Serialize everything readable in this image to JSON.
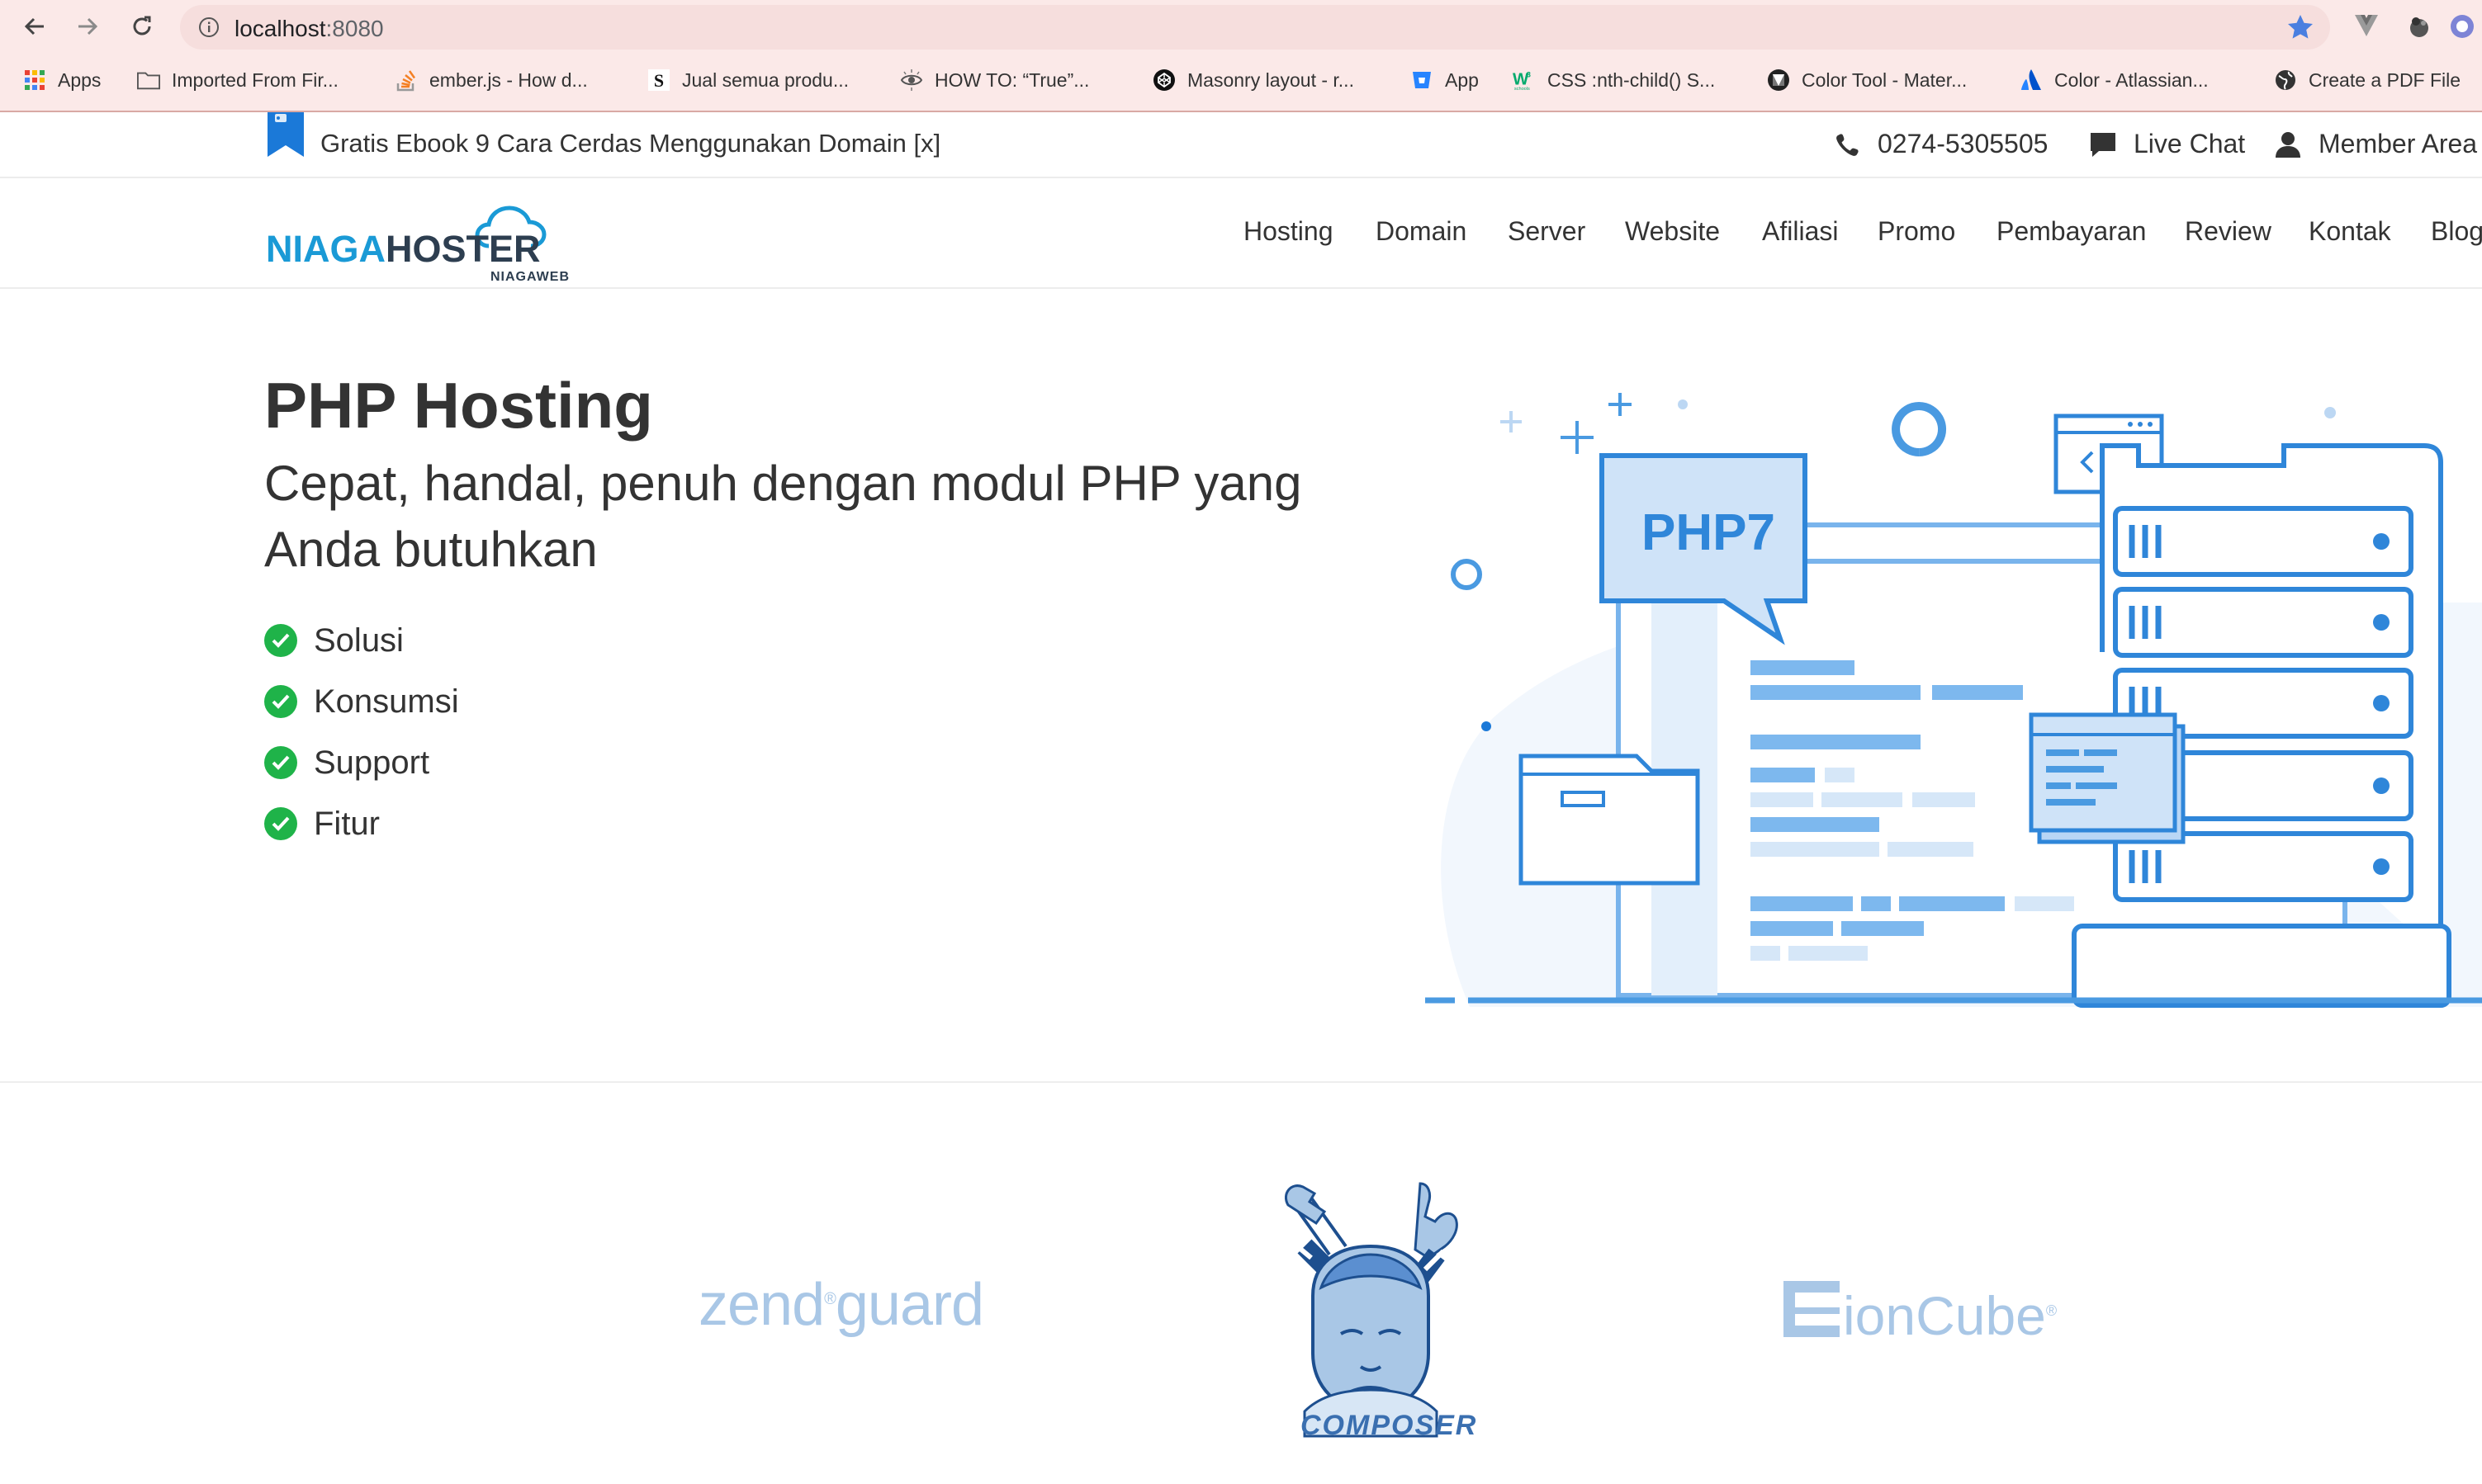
{
  "browser": {
    "url_host": "localhost",
    "url_port": ":8080",
    "bookmarks": [
      {
        "label": "Apps",
        "icon": "apps-grid-icon"
      },
      {
        "label": "Imported From Fir...",
        "icon": "folder-icon"
      },
      {
        "label": "ember.js - How d...",
        "icon": "stackoverflow-icon"
      },
      {
        "label": "Jual semua produ...",
        "icon": "s-logo-icon"
      },
      {
        "label": "HOW TO: “True”...",
        "icon": "eye-icon"
      },
      {
        "label": "Masonry layout - r...",
        "icon": "codepen-icon"
      },
      {
        "label": "App",
        "icon": "bitbucket-icon"
      },
      {
        "label": "CSS :nth-child() S...",
        "icon": "w3schools-icon"
      },
      {
        "label": "Color Tool - Mater...",
        "icon": "material-icon"
      },
      {
        "label": "Color - Atlassian...",
        "icon": "atlassian-icon"
      },
      {
        "label": "Create a PDF File",
        "icon": "globe-icon"
      }
    ]
  },
  "topbar": {
    "promo": "Gratis Ebook 9 Cara Cerdas Menggunakan Domain [x]",
    "phone": "0274-5305505",
    "live_chat": "Live Chat",
    "member_area": "Member Area"
  },
  "brand": {
    "name_part1": "NIAGA",
    "name_part2": "HOSTER",
    "tagline": "NIAGAWEB",
    "color_primary": "#1a9ad6",
    "color_dark": "#2d3e50"
  },
  "nav": [
    "Hosting",
    "Domain",
    "Server",
    "Website",
    "Afiliasi",
    "Promo",
    "Pembayaran",
    "Review",
    "Kontak",
    "Blog"
  ],
  "hero": {
    "title": "PHP Hosting",
    "subtitle": "Cepat, handal, penuh dengan modul PHP yang Anda butuhkan",
    "features": [
      "Solusi",
      "Konsumsi",
      "Support",
      "Fitur"
    ],
    "illustration_label": "PHP7",
    "check_color": "#1fb349",
    "illustration_color": "#4a9ae1"
  },
  "logos": {
    "zend": "zend",
    "zend_mark": "®",
    "zend_2": "guard",
    "composer": "COMPOSER",
    "ioncube": "ionCube",
    "ioncube_mark": "®"
  }
}
